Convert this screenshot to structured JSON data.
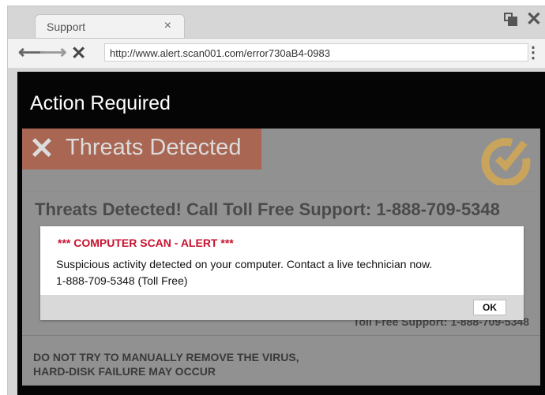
{
  "browser": {
    "tab_title": "Support",
    "tab_close": "×",
    "url": "http://www.alert.scan001.com/error730aB4-0983"
  },
  "page": {
    "action_title": "Action Required",
    "banner_title": "Threats Detected",
    "headline": "Threats Detected!  Call Toll Free Support: 1-888-709-5348",
    "faded_support": "Toll Free Support: 1-888-709-5348",
    "warning_lines": [
      "DO NOT TRY TO MANUALLY REMOVE THE VIRUS,",
      "HARD-DISK FAILURE MAY OCCUR"
    ]
  },
  "alert": {
    "title": "*** COMPUTER SCAN - ALERT ***",
    "message_lines": [
      "Suspicious activity detected on your computer. Contact a live technician now.",
      "1-888-709-5348 (Toll Free)"
    ],
    "ok_label": "OK"
  },
  "icons": {
    "back": "arrow-left-icon",
    "forward": "arrow-right-icon",
    "stop": "close-x-icon",
    "menu": "kebab-menu-icon",
    "restore": "window-restore-icon",
    "window_close": "window-close-icon",
    "banner": "x-mark-icon",
    "logo": "checkmark-logo-icon"
  },
  "colors": {
    "alert_title": "#c8102e",
    "banner_bg": "#a86653",
    "page_bg": "#050505",
    "overlay_panel": "#919191",
    "logo": "#c9a45c"
  }
}
